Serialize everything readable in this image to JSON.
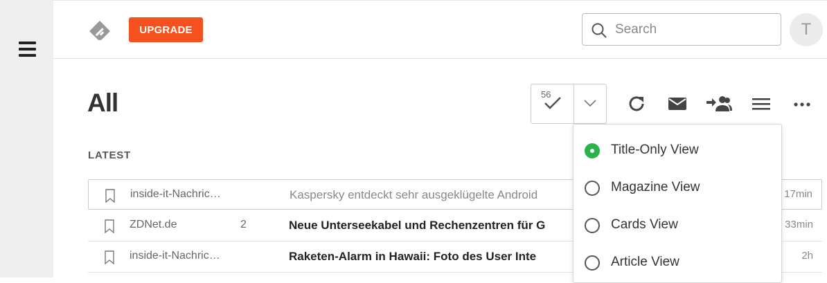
{
  "header": {
    "upgrade_label": "UPGRADE",
    "search_placeholder": "Search",
    "avatar_initial": "T"
  },
  "page": {
    "title": "All",
    "unread_count": "56",
    "section_label": "LATEST"
  },
  "articles": [
    {
      "source": "inside-it-Nachric…",
      "count": "",
      "title": "Kaspersky entdeckt sehr ausgeklügelte Android",
      "age": "17min",
      "read": true
    },
    {
      "source": "ZDNet.de",
      "count": "2",
      "title": "Neue Unterseekabel und Rechenzentren für G",
      "age": "33min",
      "read": false
    },
    {
      "source": "inside-it-Nachric…",
      "count": "",
      "title": "Raketen-Alarm in Hawaii: Foto des User Inte",
      "age": "2h",
      "read": false
    }
  ],
  "view_menu": {
    "options": [
      "Title-Only View",
      "Magazine View",
      "Cards View",
      "Article View"
    ],
    "selected": "Title-Only View"
  },
  "colors": {
    "accent_upgrade": "#f4511e",
    "selected_radio": "#2bb24c"
  },
  "icons": {
    "sidebar_toggle": "hamburger-icon",
    "logo": "feedly-logo-icon",
    "search": "search-icon",
    "mark_read": "checkmark-icon",
    "dropdown": "chevron-down-icon",
    "refresh": "refresh-icon",
    "email": "email-icon",
    "share": "share-people-icon",
    "list": "list-icon",
    "more": "more-icon",
    "save": "bookmark-icon"
  }
}
